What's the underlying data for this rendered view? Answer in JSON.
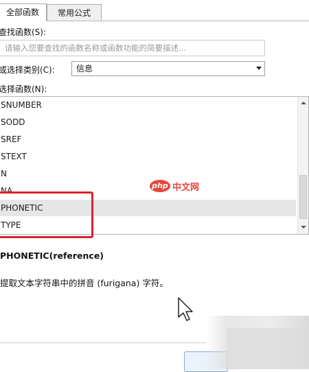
{
  "tabs": [
    {
      "label": "全部函数",
      "active": true
    },
    {
      "label": "常用公式",
      "active": false
    }
  ],
  "search": {
    "label": "查找函数(S):",
    "placeholder": "请输入您要查找的函数名称或函数功能的简要描述..."
  },
  "category": {
    "label": "或选择类别(C):",
    "selected": "信息"
  },
  "function_list": {
    "label": "选择函数(N):",
    "items": [
      "SNUMBER",
      "SODD",
      "SREF",
      "STEXT",
      "N",
      "NA",
      "PHONETIC",
      "TYPE"
    ],
    "selected_index": 6
  },
  "function_info": {
    "signature": "PHONETIC(reference)",
    "description": "提取文本字符串中的拼音 (furigana) 字符。"
  },
  "watermark": {
    "logo": "php",
    "text": "中文网"
  },
  "colors": {
    "highlight_box": "#d8232a",
    "watermark": "#e6463a",
    "selected_row": "#e6e6e6"
  }
}
